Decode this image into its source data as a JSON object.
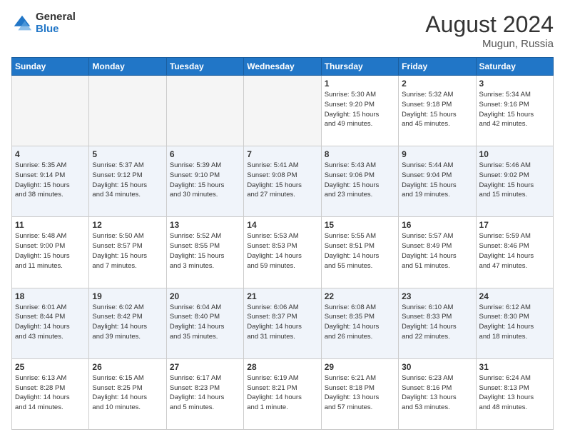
{
  "logo": {
    "general": "General",
    "blue": "Blue"
  },
  "title": {
    "month": "August 2024",
    "location": "Mugun, Russia"
  },
  "weekdays": [
    "Sunday",
    "Monday",
    "Tuesday",
    "Wednesday",
    "Thursday",
    "Friday",
    "Saturday"
  ],
  "weeks": [
    [
      {
        "day": "",
        "info": ""
      },
      {
        "day": "",
        "info": ""
      },
      {
        "day": "",
        "info": ""
      },
      {
        "day": "",
        "info": ""
      },
      {
        "day": "1",
        "info": "Sunrise: 5:30 AM\nSunset: 9:20 PM\nDaylight: 15 hours\nand 49 minutes."
      },
      {
        "day": "2",
        "info": "Sunrise: 5:32 AM\nSunset: 9:18 PM\nDaylight: 15 hours\nand 45 minutes."
      },
      {
        "day": "3",
        "info": "Sunrise: 5:34 AM\nSunset: 9:16 PM\nDaylight: 15 hours\nand 42 minutes."
      }
    ],
    [
      {
        "day": "4",
        "info": "Sunrise: 5:35 AM\nSunset: 9:14 PM\nDaylight: 15 hours\nand 38 minutes."
      },
      {
        "day": "5",
        "info": "Sunrise: 5:37 AM\nSunset: 9:12 PM\nDaylight: 15 hours\nand 34 minutes."
      },
      {
        "day": "6",
        "info": "Sunrise: 5:39 AM\nSunset: 9:10 PM\nDaylight: 15 hours\nand 30 minutes."
      },
      {
        "day": "7",
        "info": "Sunrise: 5:41 AM\nSunset: 9:08 PM\nDaylight: 15 hours\nand 27 minutes."
      },
      {
        "day": "8",
        "info": "Sunrise: 5:43 AM\nSunset: 9:06 PM\nDaylight: 15 hours\nand 23 minutes."
      },
      {
        "day": "9",
        "info": "Sunrise: 5:44 AM\nSunset: 9:04 PM\nDaylight: 15 hours\nand 19 minutes."
      },
      {
        "day": "10",
        "info": "Sunrise: 5:46 AM\nSunset: 9:02 PM\nDaylight: 15 hours\nand 15 minutes."
      }
    ],
    [
      {
        "day": "11",
        "info": "Sunrise: 5:48 AM\nSunset: 9:00 PM\nDaylight: 15 hours\nand 11 minutes."
      },
      {
        "day": "12",
        "info": "Sunrise: 5:50 AM\nSunset: 8:57 PM\nDaylight: 15 hours\nand 7 minutes."
      },
      {
        "day": "13",
        "info": "Sunrise: 5:52 AM\nSunset: 8:55 PM\nDaylight: 15 hours\nand 3 minutes."
      },
      {
        "day": "14",
        "info": "Sunrise: 5:53 AM\nSunset: 8:53 PM\nDaylight: 14 hours\nand 59 minutes."
      },
      {
        "day": "15",
        "info": "Sunrise: 5:55 AM\nSunset: 8:51 PM\nDaylight: 14 hours\nand 55 minutes."
      },
      {
        "day": "16",
        "info": "Sunrise: 5:57 AM\nSunset: 8:49 PM\nDaylight: 14 hours\nand 51 minutes."
      },
      {
        "day": "17",
        "info": "Sunrise: 5:59 AM\nSunset: 8:46 PM\nDaylight: 14 hours\nand 47 minutes."
      }
    ],
    [
      {
        "day": "18",
        "info": "Sunrise: 6:01 AM\nSunset: 8:44 PM\nDaylight: 14 hours\nand 43 minutes."
      },
      {
        "day": "19",
        "info": "Sunrise: 6:02 AM\nSunset: 8:42 PM\nDaylight: 14 hours\nand 39 minutes."
      },
      {
        "day": "20",
        "info": "Sunrise: 6:04 AM\nSunset: 8:40 PM\nDaylight: 14 hours\nand 35 minutes."
      },
      {
        "day": "21",
        "info": "Sunrise: 6:06 AM\nSunset: 8:37 PM\nDaylight: 14 hours\nand 31 minutes."
      },
      {
        "day": "22",
        "info": "Sunrise: 6:08 AM\nSunset: 8:35 PM\nDaylight: 14 hours\nand 26 minutes."
      },
      {
        "day": "23",
        "info": "Sunrise: 6:10 AM\nSunset: 8:33 PM\nDaylight: 14 hours\nand 22 minutes."
      },
      {
        "day": "24",
        "info": "Sunrise: 6:12 AM\nSunset: 8:30 PM\nDaylight: 14 hours\nand 18 minutes."
      }
    ],
    [
      {
        "day": "25",
        "info": "Sunrise: 6:13 AM\nSunset: 8:28 PM\nDaylight: 14 hours\nand 14 minutes."
      },
      {
        "day": "26",
        "info": "Sunrise: 6:15 AM\nSunset: 8:25 PM\nDaylight: 14 hours\nand 10 minutes."
      },
      {
        "day": "27",
        "info": "Sunrise: 6:17 AM\nSunset: 8:23 PM\nDaylight: 14 hours\nand 5 minutes."
      },
      {
        "day": "28",
        "info": "Sunrise: 6:19 AM\nSunset: 8:21 PM\nDaylight: 14 hours\nand 1 minute."
      },
      {
        "day": "29",
        "info": "Sunrise: 6:21 AM\nSunset: 8:18 PM\nDaylight: 13 hours\nand 57 minutes."
      },
      {
        "day": "30",
        "info": "Sunrise: 6:23 AM\nSunset: 8:16 PM\nDaylight: 13 hours\nand 53 minutes."
      },
      {
        "day": "31",
        "info": "Sunrise: 6:24 AM\nSunset: 8:13 PM\nDaylight: 13 hours\nand 48 minutes."
      }
    ]
  ]
}
